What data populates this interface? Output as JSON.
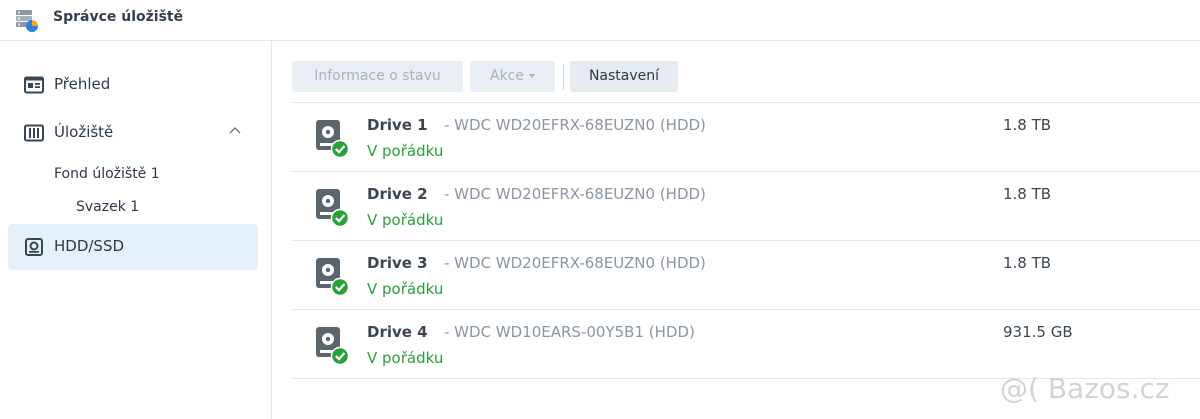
{
  "app": {
    "title": "Správce úložiště"
  },
  "sidebar": {
    "items": [
      {
        "label": "Přehled",
        "icon": "overview-icon"
      },
      {
        "label": "Úložiště",
        "icon": "storage-icon",
        "expanded": true
      },
      {
        "label": "HDD/SSD",
        "icon": "hdd-icon",
        "active": true
      }
    ],
    "subitems": [
      {
        "label": "Fond úložiště 1"
      },
      {
        "label": "Svazek 1"
      }
    ]
  },
  "toolbar": {
    "status_info": "Informace o stavu",
    "actions": "Akce",
    "settings": "Nastavení"
  },
  "drives": [
    {
      "name": "Drive 1",
      "model": "- WDC WD20EFRX-68EUZN0 (HDD)",
      "status": "V pořádku",
      "size": "1.8 TB"
    },
    {
      "name": "Drive 2",
      "model": "- WDC WD20EFRX-68EUZN0 (HDD)",
      "status": "V pořádku",
      "size": "1.8 TB"
    },
    {
      "name": "Drive 3",
      "model": "- WDC WD20EFRX-68EUZN0 (HDD)",
      "status": "V pořádku",
      "size": "1.8 TB"
    },
    {
      "name": "Drive 4",
      "model": "- WDC WD10EARS-00Y5B1 (HDD)",
      "status": "V pořádku",
      "size": "931.5 GB"
    }
  ],
  "watermark": "@( Bazos.cz",
  "colors": {
    "status_ok": "#2aa03a",
    "active_bg": "#e6f0fb"
  }
}
